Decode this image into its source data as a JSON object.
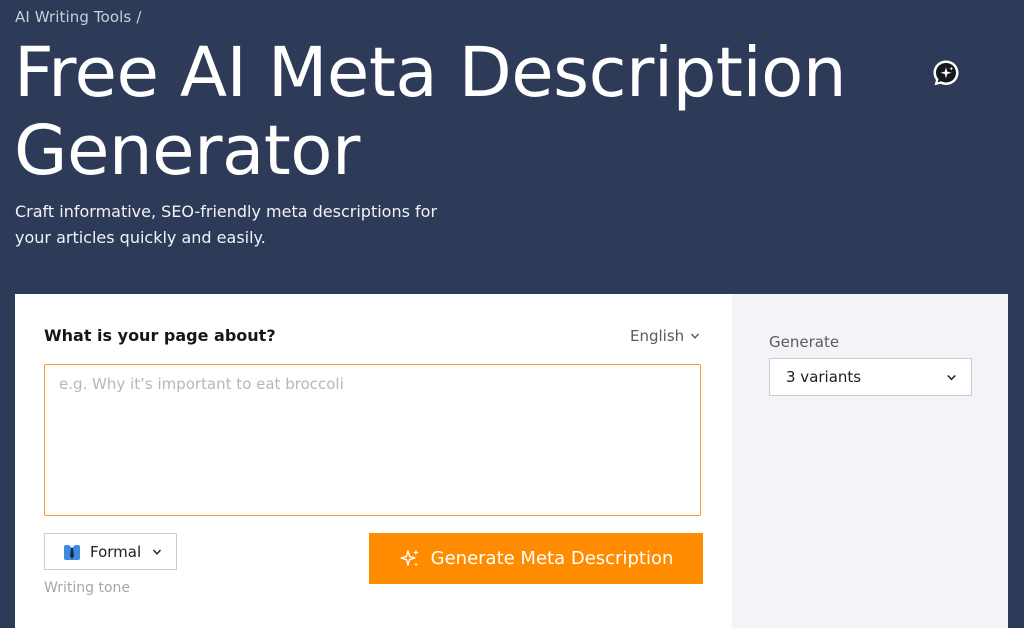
{
  "breadcrumb": {
    "parent": "AI Writing Tools",
    "separator": "/"
  },
  "hero": {
    "title": "Free AI Meta Description Generator",
    "subtitle": "Craft informative, SEO-friendly meta descriptions for your articles quickly and easily."
  },
  "form": {
    "question_label": "What is your page about?",
    "language": "English",
    "topic_placeholder": "e.g. Why it’s important to eat broccoli",
    "topic_value": "",
    "tone_value": "Formal",
    "tone_icon": "necktie-icon",
    "tone_caption": "Writing tone",
    "generate_button": "Generate Meta Description",
    "generate_icon": "sparkle-icon"
  },
  "options": {
    "generate_label": "Generate",
    "variants_value": "3 variants"
  },
  "colors": {
    "background": "#2e3b58",
    "accent": "#ff8c00",
    "input_border": "#f0a02a",
    "right_panel": "#f3f3f8"
  }
}
